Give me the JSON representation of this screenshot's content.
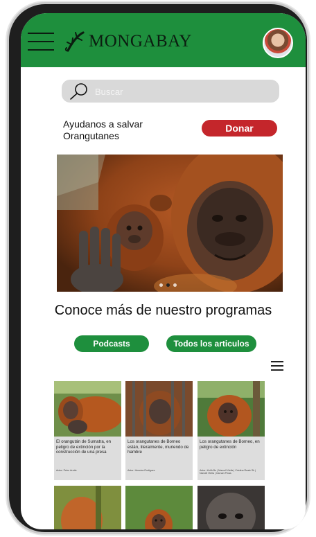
{
  "header": {
    "logo_text": "MONGABAY",
    "brand_color": "#1e8f3d"
  },
  "search": {
    "placeholder": "Buscar"
  },
  "promo": {
    "text": "Ayudanos a salvar Orangutanes",
    "donate_label": "Donar",
    "donate_color": "#c4262b"
  },
  "carousel": {
    "slide_count": 3,
    "active_index": 1
  },
  "programs": {
    "title": "Conoce más de nuestro programas",
    "buttons": [
      "Podcasts",
      "Todos los articulos"
    ]
  },
  "articles": [
    {
      "title": "El orangután de Sumatra, en peligro de extinción por la construcción de una presa",
      "author": "Autor: Petro Arotte"
    },
    {
      "title": "Los orangutanes de Borneo están, literalmente, muriendo de hambre",
      "author": "Autor: Hessica Rodiguez"
    },
    {
      "title": "Los orangutanes de Borneo, en peligro de extinción",
      "author": "Autor: Keith Bu | Marcell Viella | Cristina Reale Sk | Narcell Viella | Carnan Pinas"
    }
  ]
}
